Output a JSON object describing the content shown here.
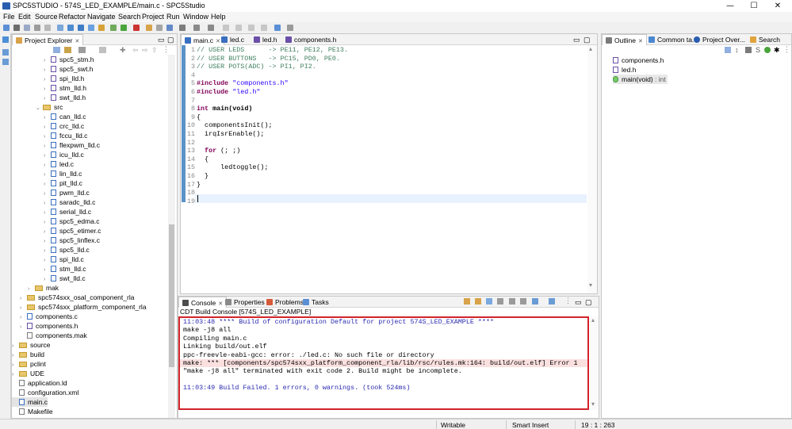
{
  "window": {
    "title": "SPC5STUDIO - 574S_LED_EXAMPLE/main.c - SPC5Studio",
    "min": "—",
    "max": "☐",
    "close": "✕"
  },
  "menu": [
    "File",
    "Edit",
    "Source",
    "Refactor",
    "Navigate",
    "Search",
    "Project",
    "Run",
    "Window",
    "Help"
  ],
  "project_explorer": {
    "tab_label": "Project Explorer",
    "items": [
      {
        "label": "spc5_stm.h",
        "kind": "h",
        "arrow": "›"
      },
      {
        "label": "spc5_swt.h",
        "kind": "h",
        "arrow": "›"
      },
      {
        "label": "spi_lld.h",
        "kind": "h",
        "arrow": "›"
      },
      {
        "label": "stm_lld.h",
        "kind": "h",
        "arrow": "›"
      },
      {
        "label": "swt_lld.h",
        "kind": "h",
        "arrow": "›"
      },
      {
        "label": "src",
        "kind": "dir",
        "arrow": "⌄"
      },
      {
        "label": "can_lld.c",
        "kind": "c",
        "arrow": "›"
      },
      {
        "label": "crc_lld.c",
        "kind": "c",
        "arrow": "›"
      },
      {
        "label": "fccu_lld.c",
        "kind": "c",
        "arrow": "›"
      },
      {
        "label": "flexpwm_lld.c",
        "kind": "c",
        "arrow": "›"
      },
      {
        "label": "icu_lld.c",
        "kind": "c",
        "arrow": "›"
      },
      {
        "label": "led.c",
        "kind": "c",
        "arrow": "›"
      },
      {
        "label": "lin_lld.c",
        "kind": "c",
        "arrow": "›"
      },
      {
        "label": "pit_lld.c",
        "kind": "c",
        "arrow": "›"
      },
      {
        "label": "pwm_lld.c",
        "kind": "c",
        "arrow": "›"
      },
      {
        "label": "saradc_lld.c",
        "kind": "c",
        "arrow": "›"
      },
      {
        "label": "serial_lld.c",
        "kind": "c",
        "arrow": "›"
      },
      {
        "label": "spc5_edma.c",
        "kind": "c",
        "arrow": "›"
      },
      {
        "label": "spc5_etimer.c",
        "kind": "c",
        "arrow": "›"
      },
      {
        "label": "spc5_linflex.c",
        "kind": "c",
        "arrow": "›"
      },
      {
        "label": "spc5_lld.c",
        "kind": "c",
        "arrow": "›"
      },
      {
        "label": "spi_lld.c",
        "kind": "c",
        "arrow": "›"
      },
      {
        "label": "stm_lld.c",
        "kind": "c",
        "arrow": "›"
      },
      {
        "label": "swt_lld.c",
        "kind": "c",
        "arrow": "›"
      },
      {
        "label": "mak",
        "kind": "dir",
        "arrow": "›"
      },
      {
        "label": "spc574sxx_osal_component_rla",
        "kind": "dir",
        "arrow": "›"
      },
      {
        "label": "spc574sxx_platform_component_rla",
        "kind": "dir",
        "arrow": "›"
      },
      {
        "label": "components.c",
        "kind": "c",
        "arrow": "›"
      },
      {
        "label": "components.h",
        "kind": "h",
        "arrow": "›"
      },
      {
        "label": "components.mak",
        "kind": "f",
        "arrow": ""
      },
      {
        "label": "source",
        "kind": "dir",
        "arrow": "›"
      },
      {
        "label": "build",
        "kind": "dir",
        "arrow": "›"
      },
      {
        "label": "pclint",
        "kind": "dir",
        "arrow": "›"
      },
      {
        "label": "UDE",
        "kind": "dir",
        "arrow": "›"
      },
      {
        "label": "application.ld",
        "kind": "f",
        "arrow": ""
      },
      {
        "label": "configuration.xml",
        "kind": "f",
        "arrow": ""
      },
      {
        "label": "main.c",
        "kind": "c",
        "arrow": ""
      },
      {
        "label": "Makefile",
        "kind": "f",
        "arrow": ""
      }
    ]
  },
  "editor": {
    "tabs": [
      "main.c",
      "led.c",
      "led.h",
      "components.h"
    ],
    "lines": [
      {
        "n": "1",
        "segs": [
          [
            "cm",
            "// USER LEDS      -> PE11, PE12, PE13."
          ]
        ]
      },
      {
        "n": "2",
        "segs": [
          [
            "cm",
            "// USER BUTTONS   -> PC15, PD0, PE0."
          ]
        ]
      },
      {
        "n": "3",
        "segs": [
          [
            "cm",
            "// USER POTS(ADC) -> PI1, PI2."
          ]
        ]
      },
      {
        "n": "4",
        "segs": []
      },
      {
        "n": "5",
        "segs": [
          [
            "kw",
            "#include "
          ],
          [
            "st",
            "\"components.h\""
          ]
        ]
      },
      {
        "n": "6",
        "segs": [
          [
            "kw",
            "#include "
          ],
          [
            "st",
            "\"led.h\""
          ]
        ]
      },
      {
        "n": "7",
        "segs": []
      },
      {
        "n": "8",
        "segs": [
          [
            "kw",
            "int "
          ],
          [
            "b",
            "main(void)"
          ]
        ]
      },
      {
        "n": "9",
        "segs": [
          [
            "",
            "{"
          ]
        ]
      },
      {
        "n": "10",
        "segs": [
          [
            "",
            "  componentsInit();"
          ]
        ]
      },
      {
        "n": "11",
        "segs": [
          [
            "",
            "  irqIsrEnable();"
          ]
        ]
      },
      {
        "n": "12",
        "segs": []
      },
      {
        "n": "13",
        "segs": [
          [
            "kw",
            "  for "
          ],
          [
            "",
            "(; ;)"
          ]
        ]
      },
      {
        "n": "14",
        "segs": [
          [
            "",
            "  {"
          ]
        ]
      },
      {
        "n": "15",
        "segs": [
          [
            "",
            "      ledtoggle();"
          ]
        ]
      },
      {
        "n": "16",
        "segs": [
          [
            "",
            "  }"
          ]
        ]
      },
      {
        "n": "17",
        "segs": [
          [
            "",
            "}"
          ]
        ]
      },
      {
        "n": "18",
        "segs": []
      },
      {
        "n": "19",
        "segs": []
      }
    ]
  },
  "outline": {
    "tabs": [
      "Outline",
      "Common ta...",
      "Project Over...",
      "Search"
    ],
    "items": [
      {
        "label": "components.h",
        "sub": ""
      },
      {
        "label": "led.h",
        "sub": ""
      },
      {
        "label": "main(void)",
        "sub": " : int"
      }
    ]
  },
  "console": {
    "tabs": [
      "Console",
      "Properties",
      "Problems",
      "Tasks"
    ],
    "header": "CDT Build Console [574S_LED_EXAMPLE]",
    "lines": [
      {
        "text": "11:03:48 **** Build of configuration Default for project 574S_LED_EXAMPLE ****",
        "color": "#2a2ab0",
        "bg": ""
      },
      {
        "text": "make -j8 all",
        "color": "#000",
        "bg": ""
      },
      {
        "text": "Compiling main.c",
        "color": "#000",
        "bg": ""
      },
      {
        "text": "Linking build/out.elf",
        "color": "#000",
        "bg": ""
      },
      {
        "text": "ppc-freevle-eabi-gcc: error: ./led.c: No such file or directory",
        "color": "#000",
        "bg": ""
      },
      {
        "text": "make: *** [components/spc574sxx_platform_component_rla/lib/rsc/rules.mk:164: build/out.elf] Error 1",
        "color": "#000",
        "bg": "#fbe0e0"
      },
      {
        "text": "\"make -j8 all\" terminated with exit code 2. Build might be incomplete.",
        "color": "#000",
        "bg": ""
      },
      {
        "text": "",
        "color": "#000",
        "bg": ""
      },
      {
        "text": "11:03:49 Build Failed. 1 errors, 0 warnings. (took 524ms)",
        "color": "#2a2ab0",
        "bg": ""
      }
    ]
  },
  "status": {
    "writable": "Writable",
    "insert": "Smart Insert",
    "pos": "19 : 1 : 263"
  },
  "colors": {
    "error_box": "#d3232a",
    "selection": "#cfe3f7"
  }
}
